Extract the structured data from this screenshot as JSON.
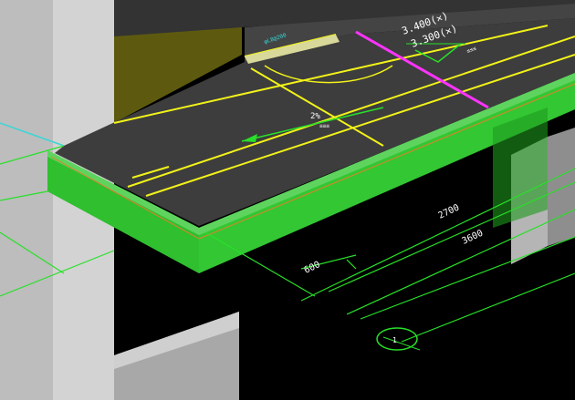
{
  "viewport": {
    "background": "#000000"
  },
  "annotations": {
    "level_upper": "3.400(✕)",
    "level_lower": "3.300(✕)",
    "level_tag": "≤≤≤",
    "slope_text": "2%",
    "slope_sub": "≡≡≡",
    "rebar_note": "φL8@200",
    "dim_600": "600",
    "dim_2700": "2700",
    "dim_3600": "3600",
    "grid_bubble": "1"
  },
  "colors": {
    "slab_green": "#2fbf2f",
    "slab_green_dark": "#1e9a1e",
    "wall_gray": "#c9c9c9",
    "wall_gray_dark": "#9b9b9b",
    "wall_olive": "#6e6a1c",
    "floor_dark": "#3a3a3a",
    "cad_yellow": "#f2f21a",
    "cad_green": "#28e028",
    "cad_magenta": "#ff33ff",
    "cad_cyan": "#39d6d6"
  }
}
